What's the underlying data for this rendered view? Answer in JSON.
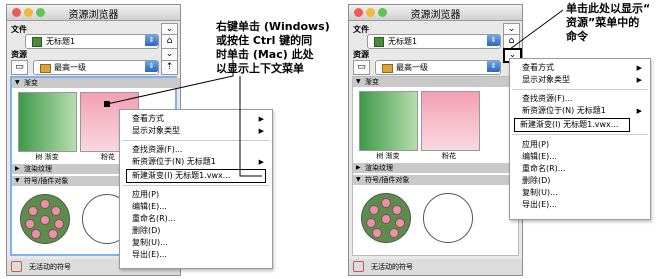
{
  "window": {
    "title": "资源浏览器"
  },
  "labels": {
    "file": "文件",
    "resources": "资源"
  },
  "file_field": {
    "value": "无标题1"
  },
  "resource_field": {
    "value": "最高一级"
  },
  "sections": {
    "gradient": "渐变",
    "render_texture": "渲染纹理",
    "symbols": "符号/插件对象"
  },
  "thumbnails": [
    {
      "caption": "树 渐变"
    },
    {
      "caption": "粉花"
    }
  ],
  "footer": {
    "status": "无活动的符号"
  },
  "context_menu": {
    "items": [
      {
        "label": "查看方式",
        "submenu": true
      },
      {
        "label": "显示对象类型",
        "submenu": true
      },
      {
        "label": "查找资源(F)...",
        "submenu": false
      },
      {
        "label": "新资源位于(N) 无标题1",
        "submenu": true
      },
      {
        "label": "新建渐变(I) 无标题1.vwx...",
        "submenu": false
      },
      {
        "label": "应用(P)",
        "submenu": false
      },
      {
        "label": "编辑(E)...",
        "submenu": false
      },
      {
        "label": "重命名(R)...",
        "submenu": false
      },
      {
        "label": "删除(D)",
        "submenu": false
      },
      {
        "label": "复制(U)...",
        "submenu": false
      },
      {
        "label": "导出(E)...",
        "submenu": false
      }
    ]
  },
  "callouts": {
    "left": [
      "右键单击 (Windows)",
      "或按住 Ctrl 键的同",
      "时单击 (Mac) 此处",
      "以显示上下文菜单"
    ],
    "right": [
      "单击此处以显示“",
      "资源”菜单中的",
      "命令"
    ]
  },
  "colors": {
    "accent_blue": "#3c86e0",
    "gradient_green": "#3d9a4a",
    "gradient_pink": "#f4a0b4"
  }
}
